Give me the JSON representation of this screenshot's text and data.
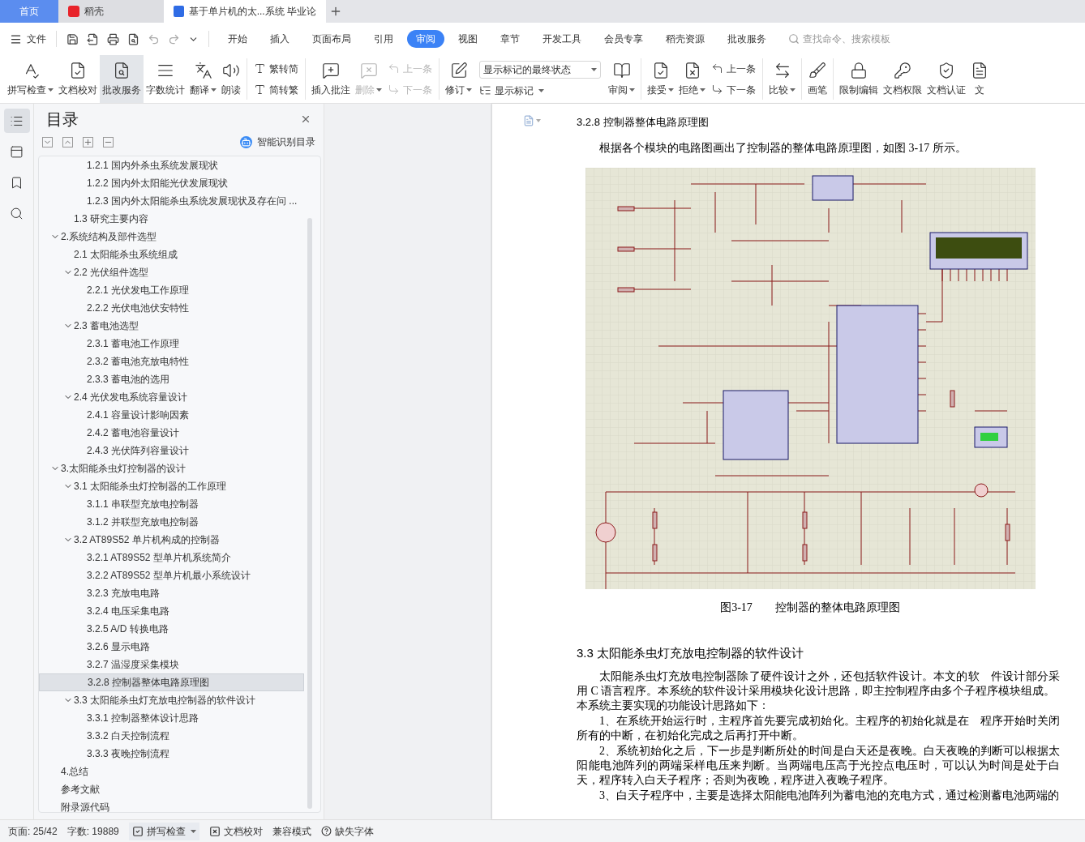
{
  "tabs": [
    {
      "label": "首页",
      "kind": "home",
      "selected": false
    },
    {
      "label": "稻壳",
      "kind": "app",
      "selected": false
    },
    {
      "label": "基于单片机的太...系统 毕业论",
      "kind": "doc",
      "selected": true
    }
  ],
  "menu": {
    "file_label": "文件",
    "items": [
      {
        "label": "开始",
        "selected": false
      },
      {
        "label": "插入",
        "selected": false
      },
      {
        "label": "页面布局",
        "selected": false
      },
      {
        "label": "引用",
        "selected": false
      },
      {
        "label": "审阅",
        "selected": true
      },
      {
        "label": "视图",
        "selected": false
      },
      {
        "label": "章节",
        "selected": false
      },
      {
        "label": "开发工具",
        "selected": false
      },
      {
        "label": "会员专享",
        "selected": false
      },
      {
        "label": "稻壳资源",
        "selected": false
      },
      {
        "label": "批改服务",
        "selected": false
      }
    ],
    "search_placeholder": "查找命令、搜索模板"
  },
  "ribbon": [
    [
      {
        "kind": "big",
        "label": "拼写检查",
        "caret": true,
        "disabled": false,
        "selected": false
      },
      {
        "kind": "big",
        "label": "文档校对",
        "caret": false,
        "disabled": false,
        "selected": false
      },
      {
        "kind": "big",
        "label": "批改服务",
        "caret": false,
        "disabled": false,
        "selected": true
      },
      {
        "kind": "big",
        "label": "字数统计",
        "caret": false,
        "disabled": false,
        "selected": false
      },
      {
        "kind": "big",
        "label": "翻译",
        "caret": true,
        "disabled": false,
        "selected": false
      },
      {
        "kind": "big",
        "label": "朗读",
        "caret": false,
        "disabled": false,
        "selected": false
      }
    ],
    [
      {
        "kind": "stack",
        "items": [
          {
            "label": "繁转简",
            "caret": false,
            "disabled": false
          },
          {
            "label": "简转繁",
            "caret": false,
            "disabled": false
          }
        ]
      }
    ],
    [
      {
        "kind": "big",
        "label": "插入批注",
        "caret": false,
        "disabled": false,
        "selected": false
      },
      {
        "kind": "big",
        "label": "删除",
        "caret": true,
        "disabled": true,
        "selected": false
      },
      {
        "kind": "stack",
        "items": [
          {
            "label": "上一条",
            "caret": false,
            "disabled": true
          },
          {
            "label": "下一条",
            "caret": false,
            "disabled": true
          }
        ]
      }
    ],
    [
      {
        "kind": "big",
        "label": "修订",
        "caret": true,
        "disabled": false,
        "selected": false
      },
      {
        "kind": "select",
        "value": "显示标记的最终状态",
        "below": {
          "label": "显示标记",
          "caret": true,
          "disabled": false
        }
      },
      {
        "kind": "big",
        "label": "审阅",
        "caret": true,
        "disabled": false,
        "selected": false
      }
    ],
    [
      {
        "kind": "big",
        "label": "接受",
        "caret": true,
        "disabled": false,
        "selected": false
      },
      {
        "kind": "big",
        "label": "拒绝",
        "caret": true,
        "disabled": false,
        "selected": false
      },
      {
        "kind": "stack",
        "items": [
          {
            "label": "上一条",
            "caret": false,
            "disabled": false
          },
          {
            "label": "下一条",
            "caret": false,
            "disabled": false
          }
        ]
      }
    ],
    [
      {
        "kind": "big",
        "label": "比较",
        "caret": true,
        "disabled": false,
        "selected": false
      }
    ],
    [
      {
        "kind": "big",
        "label": "画笔",
        "caret": false,
        "disabled": false,
        "selected": false
      }
    ],
    [
      {
        "kind": "big",
        "label": "限制编辑",
        "caret": false,
        "disabled": false,
        "selected": false
      },
      {
        "kind": "big",
        "label": "文档权限",
        "caret": false,
        "disabled": false,
        "selected": false
      },
      {
        "kind": "big",
        "label": "文档认证",
        "caret": false,
        "disabled": false,
        "selected": false
      },
      {
        "kind": "big",
        "label": "文",
        "caret": false,
        "disabled": false,
        "selected": false
      }
    ]
  ],
  "nav_icons": [
    {
      "selected": true
    },
    {
      "selected": false
    },
    {
      "selected": false
    },
    {
      "selected": false
    }
  ],
  "toc": {
    "title": "目录",
    "smart_label": "智能识别目录",
    "items": [
      {
        "children": [
          {
            "children": [
              {
                "label": "1.2.1 国内外杀虫系统发展现状",
                "selected": false
              },
              {
                "label": "1.2.2 国内外太阳能光伏发展现状",
                "selected": false
              },
              {
                "label": "1.2.3 国内外太阳能杀虫系统发展现状及存在问 ...",
                "selected": false
              }
            ]
          },
          {
            "label": "1.3  研究主要内容",
            "selected": false
          }
        ]
      },
      {
        "label": "2.系统结构及部件选型",
        "selected": false,
        "expanded": true,
        "children": [
          {
            "label": "2.1 太阳能杀虫系统组成",
            "selected": false
          },
          {
            "label": "2.2 光伏组件选型",
            "selected": false,
            "expanded": true,
            "children": [
              {
                "label": "2.2.1 光伏发电工作原理",
                "selected": false
              },
              {
                "label": "2.2.2 光伏电池伏安特性",
                "selected": false
              }
            ]
          },
          {
            "label": "2.3 蓄电池选型",
            "selected": false,
            "expanded": true,
            "children": [
              {
                "label": "2.3.1 蓄电池工作原理",
                "selected": false
              },
              {
                "label": "2.3.2 蓄电池充放电特性",
                "selected": false
              },
              {
                "label": "2.3.3 蓄电池的选用",
                "selected": false
              }
            ]
          },
          {
            "label": "2.4 光伏发电系统容量设计",
            "selected": false,
            "expanded": true,
            "children": [
              {
                "label": "2.4.1 容量设计影响因素",
                "selected": false
              },
              {
                "label": "2.4.2 蓄电池容量设计",
                "selected": false
              },
              {
                "label": "2.4.3 光伏阵列容量设计",
                "selected": false
              }
            ]
          }
        ]
      },
      {
        "label": "3.太阳能杀虫灯控制器的设计",
        "selected": false,
        "expanded": true,
        "children": [
          {
            "label": "3.1 太阳能杀虫灯控制器的工作原理",
            "selected": false,
            "expanded": true,
            "children": [
              {
                "label": "3.1.1 串联型充放电控制器",
                "selected": false
              },
              {
                "label": "3.1.2 并联型充放电控制器",
                "selected": false
              }
            ]
          },
          {
            "label": "3.2 AT89S52  单片机构成的控制器",
            "selected": false,
            "expanded": true,
            "children": [
              {
                "label": "3.2.1 AT89S52  型单片机系统简介",
                "selected": false
              },
              {
                "label": "3.2.2 AT89S52  型单片机最小系统设计",
                "selected": false
              },
              {
                "label": "3.2.3  充放电电路",
                "selected": false
              },
              {
                "label": "3.2.4  电压采集电路",
                "selected": false
              },
              {
                "label": "3.2.5 A/D  转换电路",
                "selected": false
              },
              {
                "label": "3.2.6  显示电路",
                "selected": false
              },
              {
                "label": "3.2.7  温湿度采集模块",
                "selected": false
              },
              {
                "label": "3.2.8 控制器整体电路原理图",
                "selected": true
              }
            ]
          },
          {
            "label": "3.3 太阳能杀虫灯充放电控制器的软件设计",
            "selected": false,
            "expanded": true,
            "children": [
              {
                "label": "3.3.1 控制器整体设计思路",
                "selected": false
              },
              {
                "label": "3.3.2 白天控制流程",
                "selected": false
              },
              {
                "label": "3.3.3 夜晚控制流程",
                "selected": false
              }
            ]
          }
        ]
      },
      {
        "label": "4.总结",
        "selected": false
      },
      {
        "label": "参考文献",
        "selected": false
      },
      {
        "label": "附录源代码",
        "selected": false
      }
    ]
  },
  "document": {
    "blocks": [
      {
        "kind": "heading",
        "text": "3.2.8 控制器整体电路原理图"
      },
      {
        "kind": "paragraph",
        "text": "根据各个模块的电路图画出了控制器的整体电路原理图，如图 3-17  所示。"
      },
      {
        "kind": "figure"
      },
      {
        "kind": "caption",
        "text": "图3-17　　控制器的整体电路原理图"
      },
      {
        "kind": "heading2",
        "text": "3.3 太阳能杀虫灯充放电控制器的软件设计"
      },
      {
        "kind": "paragraph",
        "text": "太阳能杀虫灯充放电控制器除了硬件设计之外，还包括软件设计。本文的软　件设计部分采用 C 语言程序。本系统的软件设计采用模块化设计思路，即主控制程序由多个子程序模块组成。"
      },
      {
        "kind": "plain",
        "text": "本系统主要实现的功能设计思路如下："
      },
      {
        "kind": "paragraph",
        "text": "1、在系统开始运行时，主程序首先要完成初始化。主程序的初始化就是在　程序开始时关闭所有的中断，在初始化完成之后再打开中断。"
      },
      {
        "kind": "paragraph",
        "text": "2、系统初始化之后，下一步是判断所处的时间是白天还是夜晚。白天夜晚的判断可以根据太阳能电池阵列的两端采样电压来判断。当两端电压高于光控点电压时，可以认为时间是处于白天，程序转入白天子程序；否则为夜晚，程序进入夜晚子程序。"
      },
      {
        "kind": "paragraph",
        "text": "3、白天子程序中，主要是选择太阳能电池阵列为蓄电池的充电方式，通过检测蓄电池两端的"
      }
    ]
  },
  "status": {
    "page": "页面: 25/42",
    "words": "字数: 19889",
    "spell": "拼写检查",
    "proof": "文档校对",
    "compat": "兼容模式",
    "fonts": "缺失字体"
  }
}
